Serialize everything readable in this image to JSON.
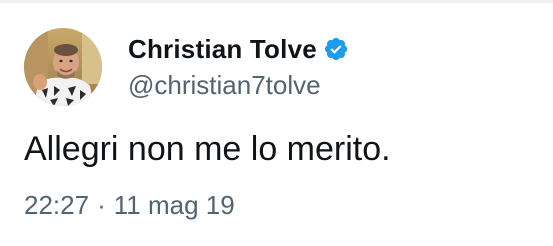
{
  "tweet": {
    "author": {
      "display_name": "Christian Tolve",
      "handle": "@christian7tolve",
      "verified": true,
      "verified_icon": "verified-badge-icon",
      "verified_color": "#1d9bf0"
    },
    "text": "Allegri non me lo merito.",
    "time": "22:27",
    "separator": "·",
    "date": "11 mag 19"
  },
  "colors": {
    "text_primary": "#0f1419",
    "text_secondary": "#536471",
    "background": "#ffffff"
  }
}
